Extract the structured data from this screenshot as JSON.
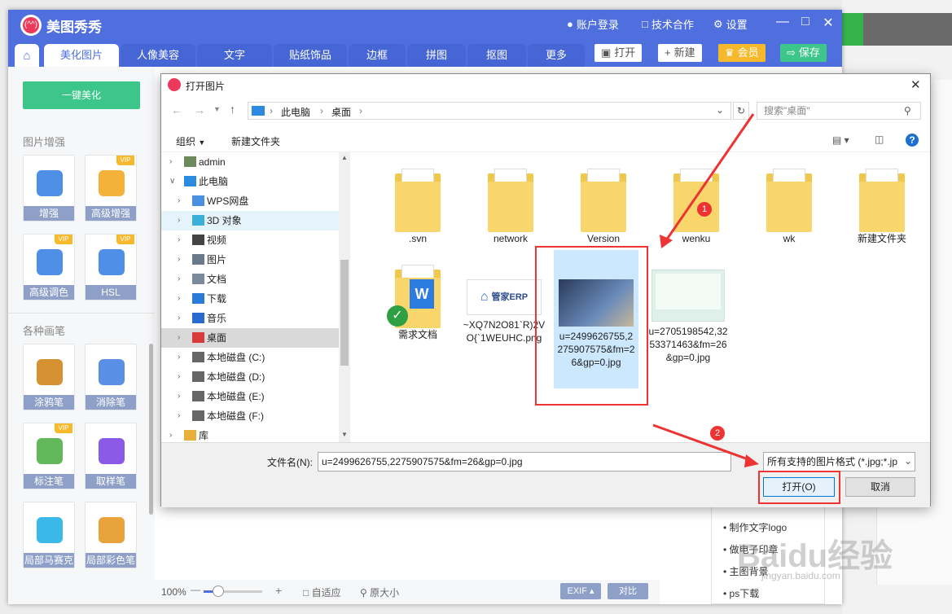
{
  "app": {
    "title": "美图秀秀",
    "logo_text": "(^^)",
    "account": "账户登录",
    "tech": "技术合作",
    "settings": "设置"
  },
  "tabs": [
    "美化图片",
    "人像美容",
    "文字",
    "贴纸饰品",
    "边框",
    "拼图",
    "抠图",
    "更多"
  ],
  "toolbar": {
    "open": "打开",
    "new": "新建",
    "vip": "会员",
    "save": "保存"
  },
  "sidebar": {
    "onekey": "一键美化",
    "section1": "图片增强",
    "section2": "各种画笔",
    "tools1": [
      {
        "label": "增强",
        "vip": false,
        "color": "#4f8fe8"
      },
      {
        "label": "高级增强",
        "vip": true,
        "color": "#f4b23a"
      },
      {
        "label": "高级调色",
        "vip": true,
        "color": "#4f8fe8"
      },
      {
        "label": "HSL",
        "vip": true,
        "color": "#4f8fe8"
      }
    ],
    "tools2": [
      {
        "label": "涂鸦笔",
        "vip": false,
        "color": "#d59132"
      },
      {
        "label": "消除笔",
        "vip": false,
        "color": "#5a8fe6"
      },
      {
        "label": "标注笔",
        "vip": true,
        "color": "#63b85c"
      },
      {
        "label": "取样笔",
        "vip": false,
        "color": "#8a5ae6"
      },
      {
        "label": "局部马赛克",
        "vip": false,
        "color": "#3ab8e8"
      },
      {
        "label": "局部彩色笔",
        "vip": false,
        "color": "#e8a43a"
      }
    ]
  },
  "bottombar": {
    "zoom": "100%",
    "fit": "自适应",
    "original": "原大小",
    "exif": "EXIF",
    "compare": "对比"
  },
  "right_panel": {
    "items": [
      "制作文字logo",
      "做电子印章",
      "主图背景",
      "ps下载"
    ]
  },
  "watermark": {
    "text": "Baidu经验",
    "url": "jingyan.baidu.com"
  },
  "dialog": {
    "title": "打开图片",
    "breadcrumb": [
      "此电脑",
      "桌面"
    ],
    "search_placeholder": "搜索\"桌面\"",
    "organize": "组织",
    "new_folder": "新建文件夹",
    "nav": [
      {
        "label": "admin",
        "icon": "user-icon",
        "indent": 0,
        "expanded": false
      },
      {
        "label": "此电脑",
        "icon": "computer-icon",
        "indent": 0,
        "expanded": true
      },
      {
        "label": "WPS网盘",
        "icon": "cloud-icon",
        "indent": 1
      },
      {
        "label": "3D 对象",
        "icon": "cube-icon",
        "indent": 1,
        "hover": true
      },
      {
        "label": "视频",
        "icon": "video-icon",
        "indent": 1
      },
      {
        "label": "图片",
        "icon": "picture-icon",
        "indent": 1
      },
      {
        "label": "文档",
        "icon": "document-icon",
        "indent": 1
      },
      {
        "label": "下载",
        "icon": "download-icon",
        "indent": 1
      },
      {
        "label": "音乐",
        "icon": "music-icon",
        "indent": 1
      },
      {
        "label": "桌面",
        "icon": "desktop-icon",
        "indent": 1,
        "selected": true
      },
      {
        "label": "本地磁盘 (C:)",
        "icon": "drive-icon",
        "indent": 1
      },
      {
        "label": "本地磁盘 (D:)",
        "icon": "drive-icon",
        "indent": 1
      },
      {
        "label": "本地磁盘 (E:)",
        "icon": "drive-icon",
        "indent": 1
      },
      {
        "label": "本地磁盘 (F:)",
        "icon": "drive-icon",
        "indent": 1
      },
      {
        "label": "库",
        "icon": "library-icon",
        "indent": 0
      }
    ],
    "files": [
      {
        "name": ".svn",
        "type": "folder"
      },
      {
        "name": "network",
        "type": "folder"
      },
      {
        "name": "Version",
        "type": "folder"
      },
      {
        "name": "wenku",
        "type": "folder"
      },
      {
        "name": "wk",
        "type": "folder"
      },
      {
        "name": "新建文件夹",
        "type": "folder"
      },
      {
        "name": "需求文档",
        "type": "folder-doc"
      },
      {
        "name": "~XQ7N2O81`R)2VO{`1WEUHC.png",
        "type": "image-erp"
      },
      {
        "name": "u=2499626755,2275907575&fm=26&gp=0.jpg",
        "type": "image-photo",
        "selected": true
      },
      {
        "name": "u=2705198542,3253371463&fm=26&gp=0.jpg",
        "type": "image-card"
      }
    ],
    "erp_text": "管家ERP",
    "filename_label": "文件名(N):",
    "filename_value": "u=2499626755,2275907575&fm=26&gp=0.jpg",
    "filetype": "所有支持的图片格式 (*.jpg;*.jp",
    "open_button": "打开(O)",
    "cancel_button": "取消",
    "annotations": [
      "1",
      "2"
    ],
    "annotation_color": "#e33333"
  }
}
